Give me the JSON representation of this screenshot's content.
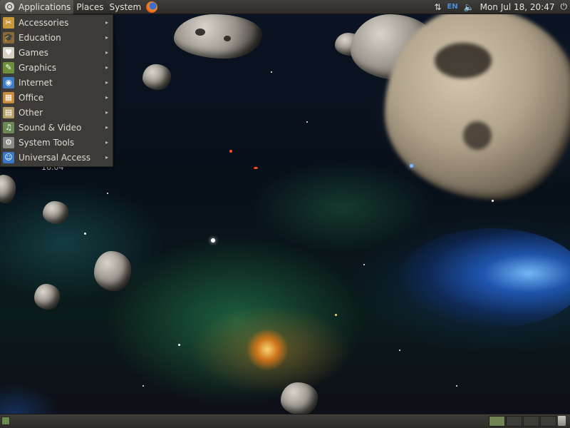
{
  "top_panel": {
    "menus": [
      {
        "label": "Applications",
        "icon": "ubuntu-logo-icon",
        "active": true
      },
      {
        "label": "Places"
      },
      {
        "label": "System"
      }
    ],
    "launcher_icon": "firefox-icon",
    "tray": {
      "network_icon": "network-arrows-icon",
      "language": "EN",
      "volume_icon": "speaker-icon",
      "clock": "Mon Jul 18, 20:47",
      "power_icon": "power-icon"
    }
  },
  "applications_menu": {
    "items": [
      {
        "label": "Accessories",
        "icon": "accessories-icon",
        "color": "#c79a3b",
        "glyph": "✂"
      },
      {
        "label": "Education",
        "icon": "education-icon",
        "color": "#8a6a3a",
        "glyph": "🎓"
      },
      {
        "label": "Games",
        "icon": "games-icon",
        "color": "#d9d2c4",
        "glyph": "♥"
      },
      {
        "label": "Graphics",
        "icon": "graphics-icon",
        "color": "#6e8f3c",
        "glyph": "✎"
      },
      {
        "label": "Internet",
        "icon": "internet-icon",
        "color": "#3f7fc7",
        "glyph": "◉"
      },
      {
        "label": "Office",
        "icon": "office-icon",
        "color": "#c98b3a",
        "glyph": "▦"
      },
      {
        "label": "Other",
        "icon": "other-icon",
        "color": "#b5a06a",
        "glyph": "▤"
      },
      {
        "label": "Sound & Video",
        "icon": "sound-video-icon",
        "color": "#6b8a55",
        "glyph": "♫"
      },
      {
        "label": "System Tools",
        "icon": "system-tools-icon",
        "color": "#8c8c86",
        "glyph": "⚙"
      },
      {
        "label": "Universal Access",
        "icon": "universal-access-icon",
        "color": "#3a78c8",
        "glyph": "☺"
      }
    ],
    "submenu_arrow": "▸"
  },
  "desktop": {
    "version_label": "16.04"
  },
  "bottom_panel": {
    "show_desktop_icon": "show-desktop-icon",
    "workspace_count": 4,
    "current_workspace": 1,
    "trash_icon": "trash-icon"
  }
}
